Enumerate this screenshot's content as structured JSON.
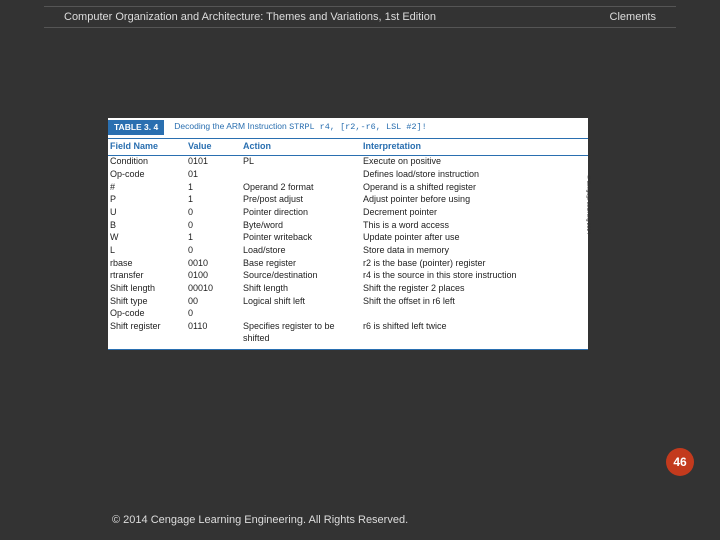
{
  "header": {
    "title_pre": "Computer Organization and Architecture: Themes and Variations, 1",
    "title_sup": "st",
    "title_post": " Edition",
    "author": "Clements"
  },
  "chart_data": {
    "type": "table",
    "caption_tag": "TABLE 3. 4",
    "caption_text_a": "Decoding the ARM Instruction ",
    "caption_code": "STRPL  r4,  [r2,-r6, LSL #2]!",
    "headers": {
      "c1": "Field Name",
      "c2": "Value",
      "c3": "Action",
      "c4": "Interpretation"
    },
    "rows": [
      {
        "c1": "Condition",
        "c2": "0101",
        "c3": "PL",
        "c4": "Execute on positive"
      },
      {
        "c1": "Op-code",
        "c2": "01",
        "c3": "",
        "c4": "Defines load/store instruction"
      },
      {
        "c1": "#",
        "c2": "1",
        "c3": "Operand 2 format",
        "c4": "Operand is a shifted register"
      },
      {
        "c1": "P",
        "c2": "1",
        "c3": "Pre/post adjust",
        "c4": "Adjust pointer before using"
      },
      {
        "c1": "U",
        "c2": "0",
        "c3": "Pointer direction",
        "c4": "Decrement pointer"
      },
      {
        "c1": "B",
        "c2": "0",
        "c3": "Byte/word",
        "c4": "This is a word access"
      },
      {
        "c1": "W",
        "c2": "1",
        "c3": "Pointer writeback",
        "c4": "Update pointer after use"
      },
      {
        "c1": "L",
        "c2": "0",
        "c3": "Load/store",
        "c4": "Store data in memory"
      },
      {
        "c1": "rbase",
        "c2": "0010",
        "c3": "Base register",
        "c4": "r2 is the base (pointer) register"
      },
      {
        "c1": "rtransfer",
        "c2": "0100",
        "c3": "Source/destination",
        "c4": "r4 is the source in this store instruction"
      },
      {
        "c1": "Shift length",
        "c2": "00010",
        "c3": "Shift length",
        "c4": "Shift the register 2 places"
      },
      {
        "c1": "Shift type",
        "c2": "00",
        "c3": "Logical shift left",
        "c4": "Shift the offset in r6 left"
      },
      {
        "c1": "Op-code",
        "c2": "0",
        "c3": "",
        "c4": ""
      },
      {
        "c1": "Shift register",
        "c2": "0110",
        "c3": "Specifies register to be shifted",
        "c4": "r6 is shifted left twice"
      }
    ],
    "side_credit": "© Cengage Learning 2014"
  },
  "page_number": "46",
  "footer": "© 2014 Cengage Learning Engineering. All Rights Reserved."
}
